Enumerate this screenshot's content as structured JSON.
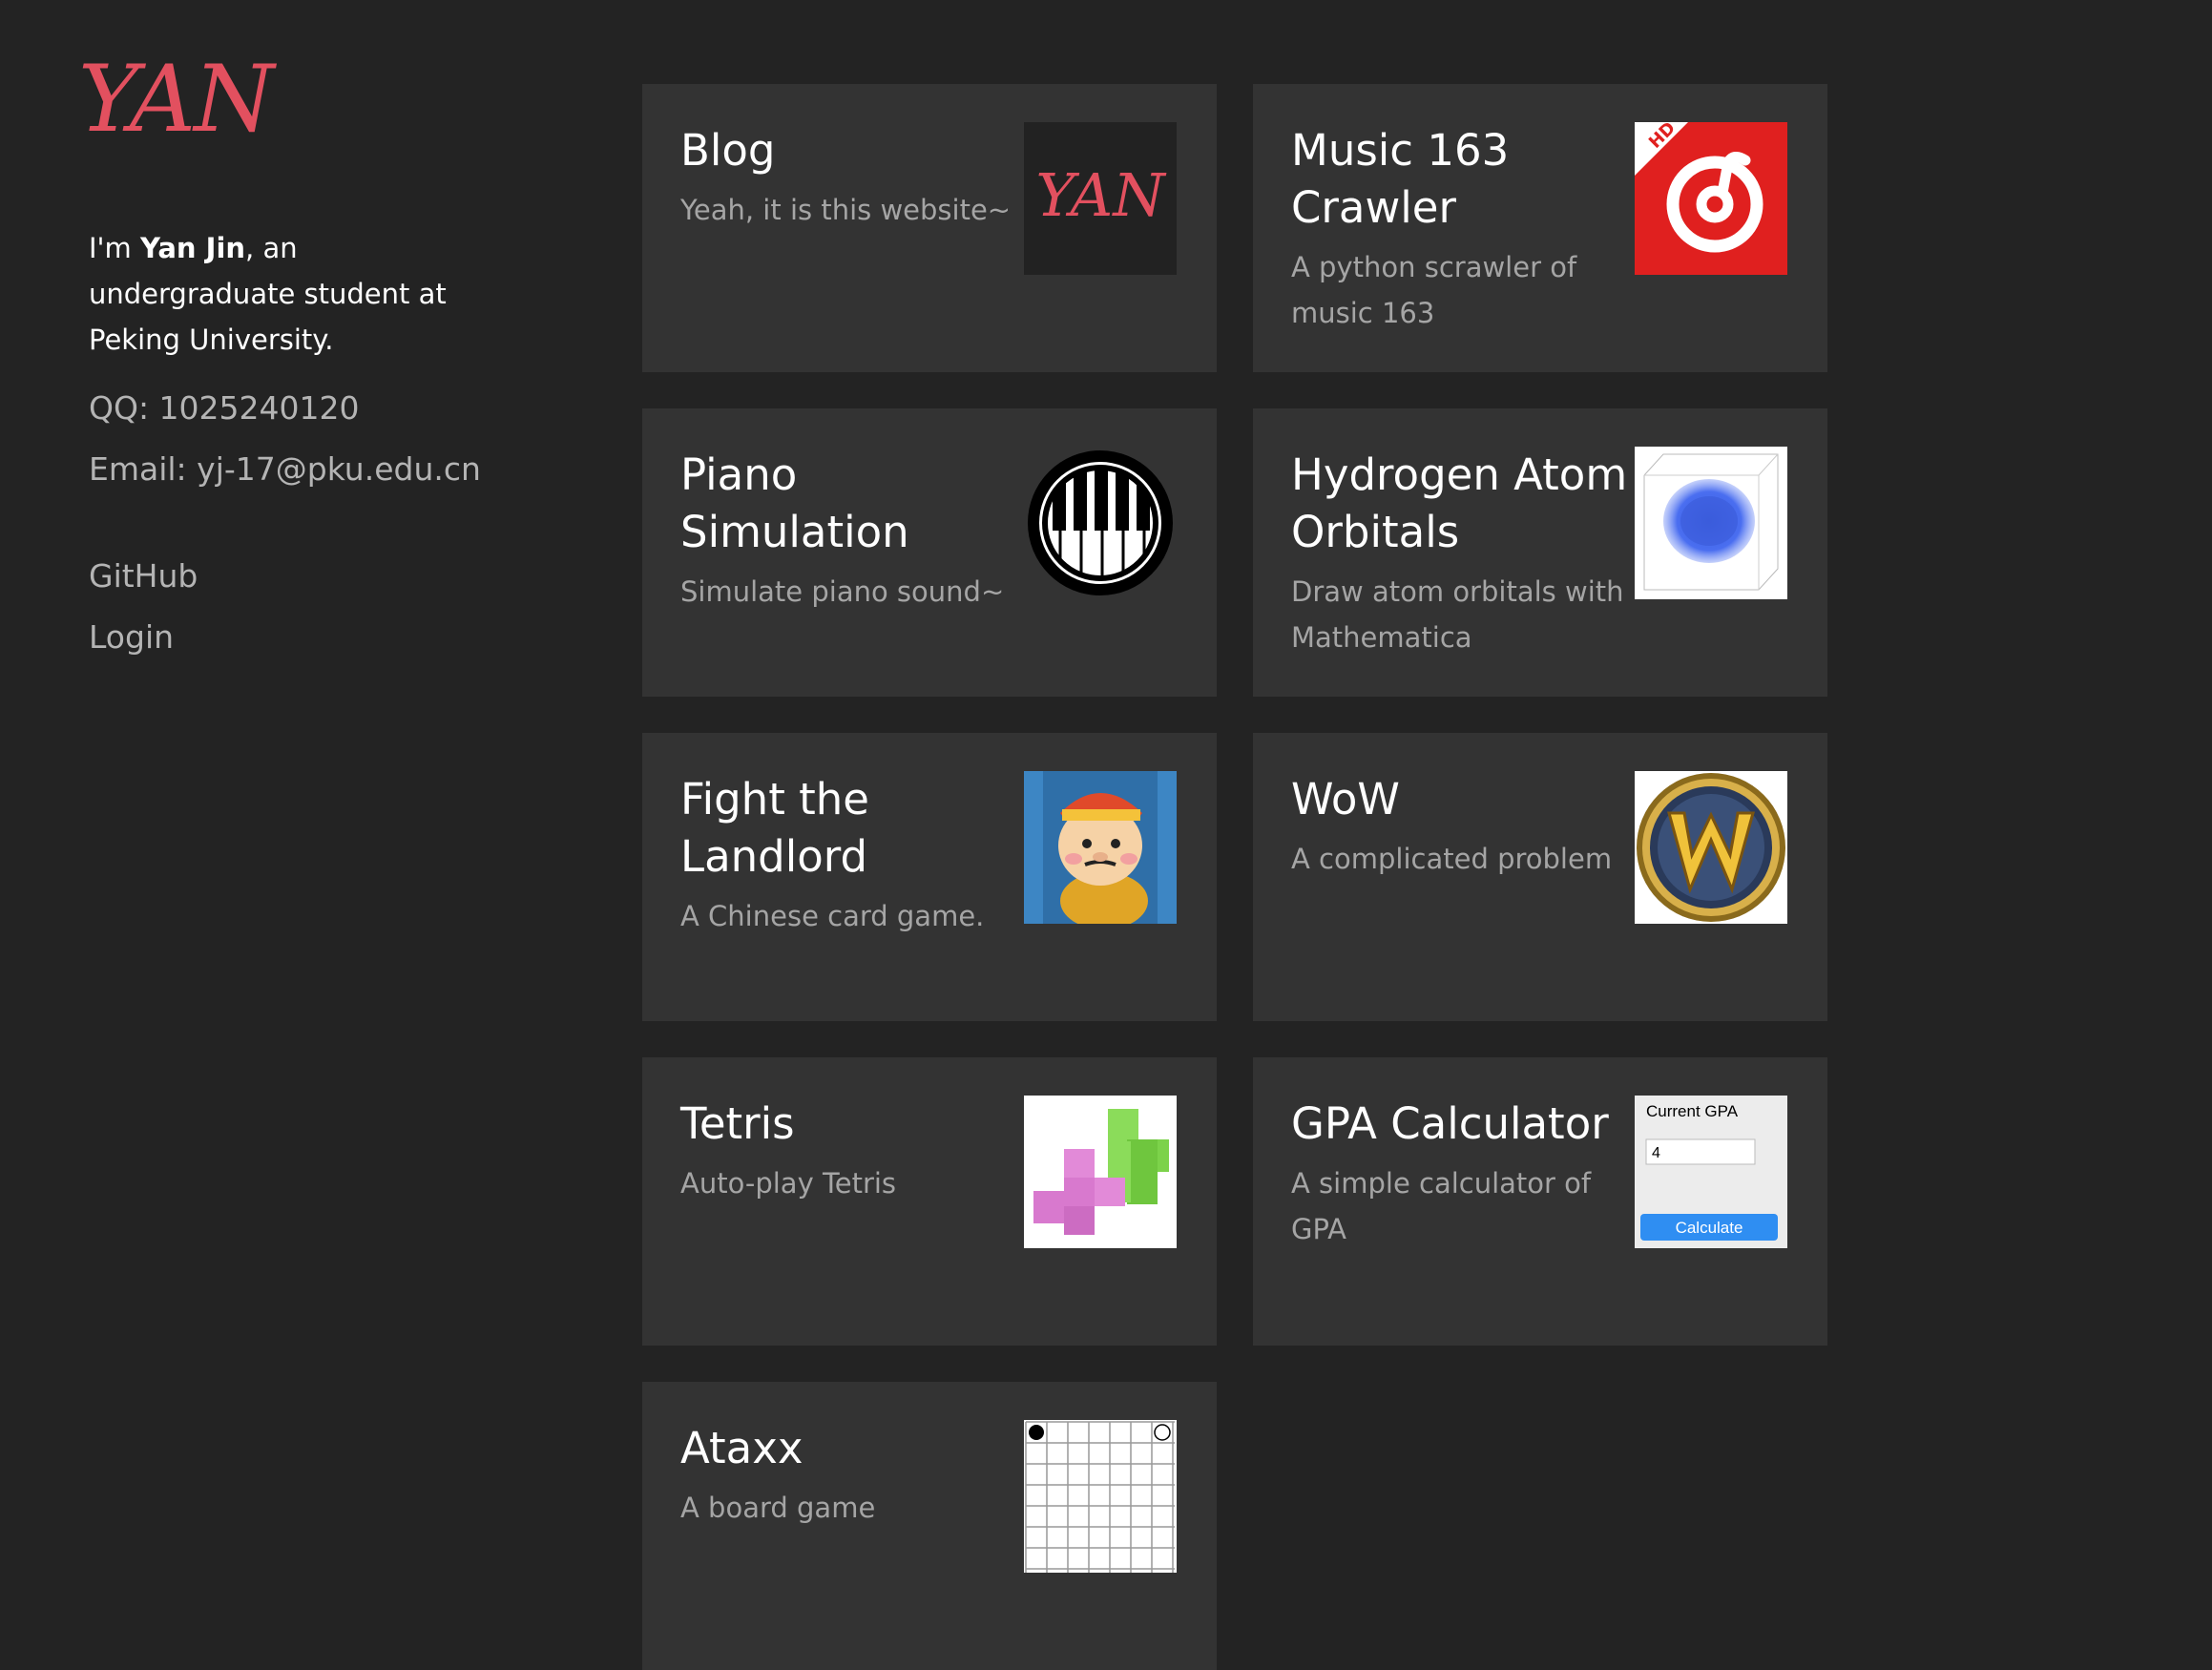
{
  "sidebar": {
    "logo": "YAN",
    "intro_prefix": "I'm ",
    "intro_name": "Yan Jin",
    "intro_suffix": ", an undergraduate student at Peking University.",
    "qq": "QQ: 1025240120",
    "email": "Email: yj-17@pku.edu.cn",
    "links": [
      "GitHub",
      "Login"
    ]
  },
  "projects": [
    {
      "title": "Blog",
      "desc": "Yeah, it is this website~",
      "icon": "yan-logo-thumb"
    },
    {
      "title": "Music 163 Crawler",
      "desc": "A python scrawler of music 163",
      "icon": "netease-music-icon"
    },
    {
      "title": "Piano Simulation",
      "desc": "Simulate piano sound~",
      "icon": "piano-icon"
    },
    {
      "title": "Hydrogen Atom Orbitals",
      "desc": "Draw atom orbitals with Mathematica",
      "icon": "orbital-plot"
    },
    {
      "title": "Fight the Landlord",
      "desc": "A Chinese card game.",
      "icon": "landlord-character-icon"
    },
    {
      "title": "WoW",
      "desc": "A complicated problem",
      "icon": "wow-logo-icon"
    },
    {
      "title": "Tetris",
      "desc": "Auto-play Tetris",
      "icon": "tetris-blocks-icon"
    },
    {
      "title": "GPA Calculator",
      "desc": "A simple calculator of GPA",
      "icon": "gpa-calculator-thumb"
    },
    {
      "title": "Ataxx",
      "desc": "A board game",
      "icon": "ataxx-board-thumb"
    }
  ],
  "thumbs": {
    "netease_badge": "HD",
    "gpa_label": "Current GPA",
    "gpa_value": "4",
    "gpa_button": "Calculate"
  },
  "colors": {
    "background": "#232323",
    "card": "#333333",
    "accent": "#e2505f"
  }
}
